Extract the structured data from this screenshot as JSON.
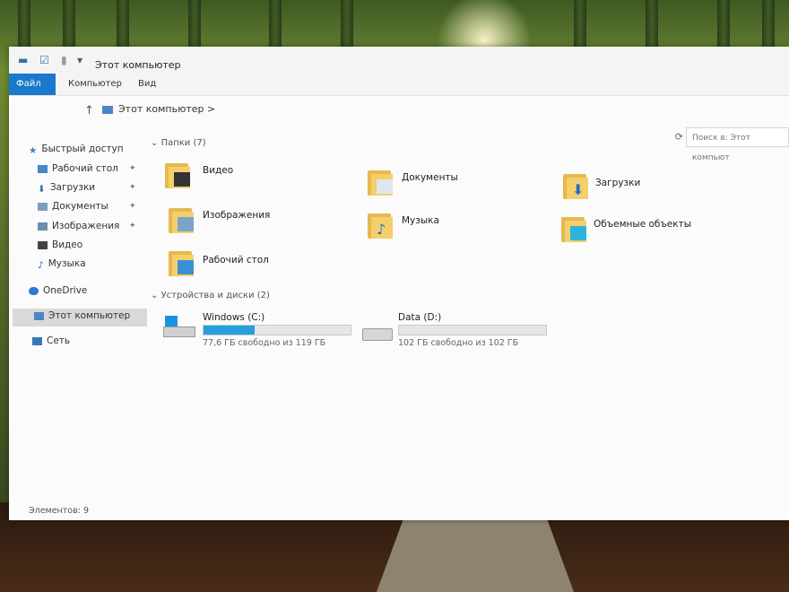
{
  "window": {
    "title": "Этот компьютер",
    "tabs": [
      "Файл",
      "Компьютер",
      "Вид"
    ]
  },
  "address": {
    "path": "Этот компьютер",
    "search_placeholder": "Поиск в: Этот компьют"
  },
  "sidebar": {
    "quick_access": "Быстрый доступ",
    "items": [
      {
        "label": "Рабочий стол",
        "icon": "desktop-icon",
        "pinned": true
      },
      {
        "label": "Загрузки",
        "icon": "download-icon",
        "pinned": true
      },
      {
        "label": "Документы",
        "icon": "documents-icon",
        "pinned": true
      },
      {
        "label": "Изображения",
        "icon": "pictures-icon",
        "pinned": true
      },
      {
        "label": "Видео",
        "icon": "video-icon",
        "pinned": false
      },
      {
        "label": "Музыка",
        "icon": "music-icon",
        "pinned": false
      }
    ],
    "onedrive": "OneDrive",
    "this_pc": "Этот компьютер",
    "network": "Сеть"
  },
  "folders": {
    "header": "Папки (7)",
    "items": [
      "Видео",
      "Документы",
      "Загрузки",
      "Изображения",
      "Музыка",
      "Объемные объекты",
      "Рабочий стол"
    ]
  },
  "drives": {
    "header": "Устройства и диски (2)",
    "items": [
      {
        "name": "Windows (C:)",
        "free": "77,6 ГБ свободно из 119 ГБ",
        "used_fraction": 0.35
      },
      {
        "name": "Data (D:)",
        "free": "102 ГБ свободно из 102 ГБ",
        "used_fraction": 0.0
      }
    ]
  },
  "status": "Элементов: 9",
  "colors": {
    "accent": "#1979ca",
    "folder": "#f4cf6b",
    "drive_fill": "#27a0de"
  }
}
